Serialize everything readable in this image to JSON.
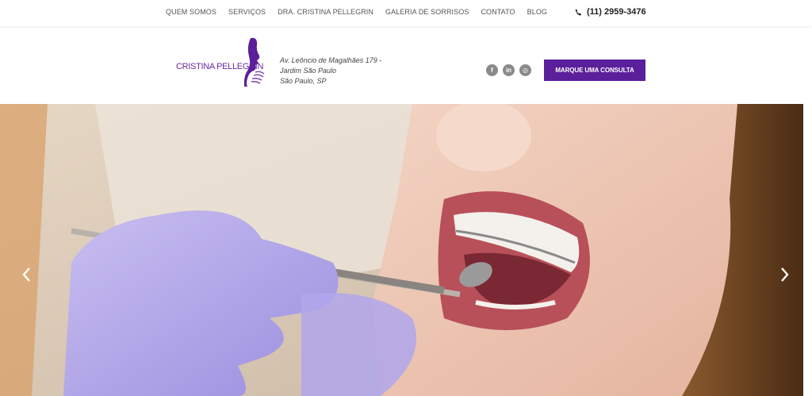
{
  "nav": {
    "items": [
      "QUEM SOMOS",
      "SERVIÇOS",
      "DRA. CRISTINA PELLEGRIN",
      "GALERIA DE SORRISOS",
      "CONTATO",
      "BLOG"
    ],
    "phone": "(11) 2959-3476"
  },
  "header": {
    "logo_text": "CRISTINA PELLEGRIN",
    "address": [
      "Av. Leôncio de Magalhães 179 -",
      "Jardim São Paulo",
      "São Paulo, SP"
    ],
    "social": [
      {
        "icon": "facebook-icon",
        "glyph": "f"
      },
      {
        "icon": "linkedin-icon",
        "glyph": "in"
      },
      {
        "icon": "instagram-icon",
        "glyph": "◎"
      }
    ],
    "cta_label": "MARQUE UMA CONSULTA"
  },
  "colors": {
    "brand_purple": "#5a1f9a",
    "logo_purple": "#6a2a9e"
  }
}
